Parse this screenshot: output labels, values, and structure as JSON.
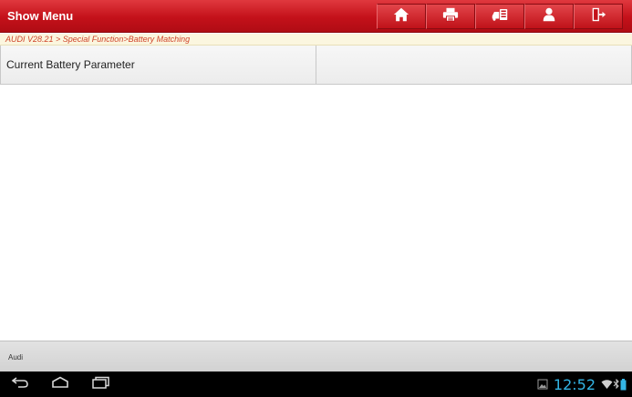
{
  "header": {
    "title": "Show Menu",
    "buttons": [
      {
        "icon": "home-icon"
      },
      {
        "icon": "printer-icon"
      },
      {
        "icon": "diagnostic-icon"
      },
      {
        "icon": "user-icon"
      },
      {
        "icon": "exit-icon"
      }
    ]
  },
  "breadcrumb": "AUDI V28.21 > Special Function>Battery Matching",
  "table": {
    "rows": [
      {
        "name": "Current Battery Parameter",
        "value": ""
      }
    ]
  },
  "footer": {
    "vehicle": "Audi"
  },
  "status_bar": {
    "time": "12:52",
    "icons": [
      "gallery-icon",
      "wifi-icon",
      "bluetooth-icon",
      "battery-icon"
    ]
  },
  "nav_bar": {
    "icons": [
      "back-icon",
      "home-nav-icon",
      "recent-apps-icon"
    ]
  },
  "colors": {
    "header_red": "#c4111a",
    "breadcrumb_text": "#d0442a",
    "clock_blue": "#33b5e5"
  }
}
